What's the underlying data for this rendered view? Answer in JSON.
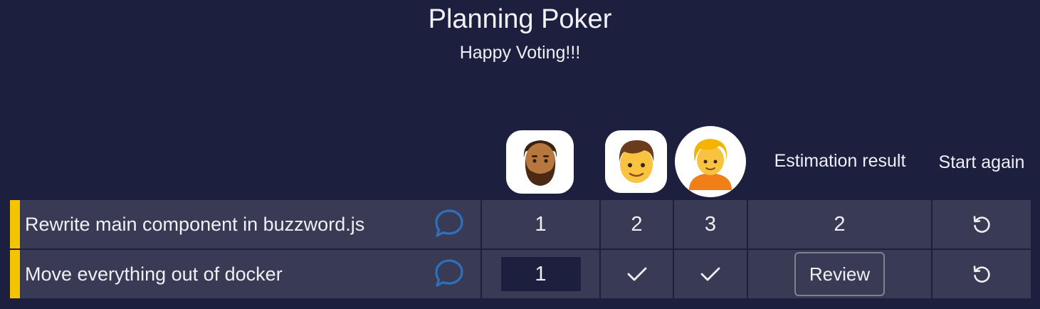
{
  "header": {
    "title": "Planning Poker",
    "subtitle": "Happy Voting!!!"
  },
  "participants": [
    {
      "icon": "bearded-man-avatar-icon"
    },
    {
      "icon": "boy-avatar-icon"
    },
    {
      "icon": "blond-person-avatar-icon"
    }
  ],
  "columns": {
    "estimation": "Estimation result",
    "start_again": "Start again"
  },
  "colors": {
    "background": "#1c1f3d",
    "row": "#393b55",
    "accent": "#f4c400",
    "comment_icon": "#2f6fc0"
  },
  "stories": [
    {
      "title": "Rewrite main component in buzzword.js",
      "votes": [
        "1",
        "2",
        "3"
      ],
      "estimation": "2"
    },
    {
      "title": "Move everything out of docker",
      "my_vote": "1",
      "votes_status": [
        "voted-check-icon",
        "voted-check-icon"
      ],
      "review_label": "Review"
    }
  ]
}
